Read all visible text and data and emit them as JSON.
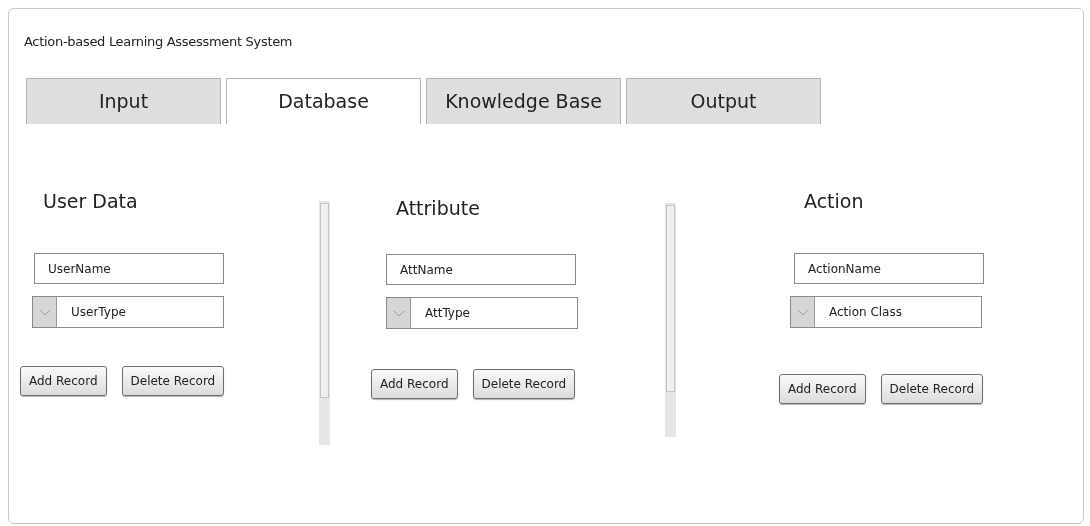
{
  "window": {
    "title": "Action-based Learning Assessment System"
  },
  "tabs": [
    {
      "label": "Input",
      "selected": false
    },
    {
      "label": "Database",
      "selected": true
    },
    {
      "label": "Knowledge Base",
      "selected": false
    },
    {
      "label": "Output",
      "selected": false
    }
  ],
  "panels": [
    {
      "heading": "User Data",
      "name_field": {
        "value": "UserName"
      },
      "type_dropdown": {
        "value": "UserType"
      },
      "buttons": [
        "Add Record",
        "Delete Record"
      ]
    },
    {
      "heading": "Attribute",
      "name_field": {
        "value": "AttName"
      },
      "type_dropdown": {
        "value": "AttType"
      },
      "buttons": [
        "Add Record",
        "Delete Record"
      ]
    },
    {
      "heading": "Action",
      "name_field": {
        "value": "ActionName"
      },
      "type_dropdown": {
        "value": "Action Class"
      },
      "buttons": [
        "Add Record",
        "Delete Record"
      ]
    }
  ]
}
